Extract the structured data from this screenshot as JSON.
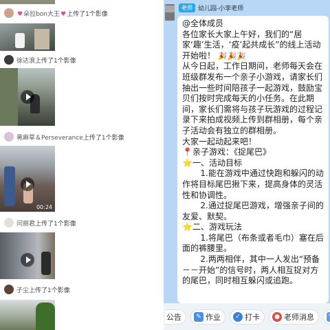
{
  "feed": {
    "entries": [
      {
        "name": "朵拉bon大王",
        "action": "上传了1个影像"
      },
      {
        "name": "徐达浪",
        "action": "上传了1个影像"
      },
      {
        "name": "蒋麻草＆Perseverance",
        "action": "上传了1个影像"
      },
      {
        "name": "闫丽君",
        "action": "上传了1个影像"
      },
      {
        "name": "子尘",
        "action": "上传了1个影像"
      }
    ],
    "video_duration": "00:24"
  },
  "chat": {
    "role_badge": "老师",
    "sender": "幼儿园-小李老师",
    "lines": [
      "@全体成员",
      "各位家长大家上午好，我们的“居家‘趣’生活，‘疫’起共成长”的线上活动开始啦！",
      "从今日起，工作日期间，老师每天会在班级群发布一个亲子小游戏，请家长们抽出一些时间陪孩子一起游戏，鼓励宝贝们按时完成每天的小任务。在此期间，家长们需将与孩子玩游戏的过程记录下来拍成视频上传到群相册，每个亲子活动会有独立的群相册。",
      "大家一起动起来吧！",
      "亲子游戏：《捉尾巴》",
      "一、活动目标",
      "1.能在游戏中通过快跑和躲闪的动作将目标尾巴揪下来，提高身体的灵活性和协调性。",
      "2.通过捉尾巴游戏，增强亲子间的友爱、默契。",
      "二、游戏玩法",
      "1.将尾巴（布条或者毛巾）塞在后面的裤腰里。",
      "2.两两相伴，其中一人发出“预备－－开始”的信号时，两人相互捉对方的尾巴，同时相互躲闪或追跑。"
    ]
  },
  "bottombar": {
    "items": [
      {
        "label": "公告",
        "icon": "announcement-icon"
      },
      {
        "label": "作业",
        "icon": "homework-icon"
      },
      {
        "label": "打卡",
        "icon": "checkin-icon"
      },
      {
        "label": "老师消息",
        "icon": "teacher-message-icon"
      }
    ]
  },
  "colors": {
    "chat_bg": "#b7d7f5",
    "badge": "#2aa7e8",
    "heart": "#e0479e"
  }
}
